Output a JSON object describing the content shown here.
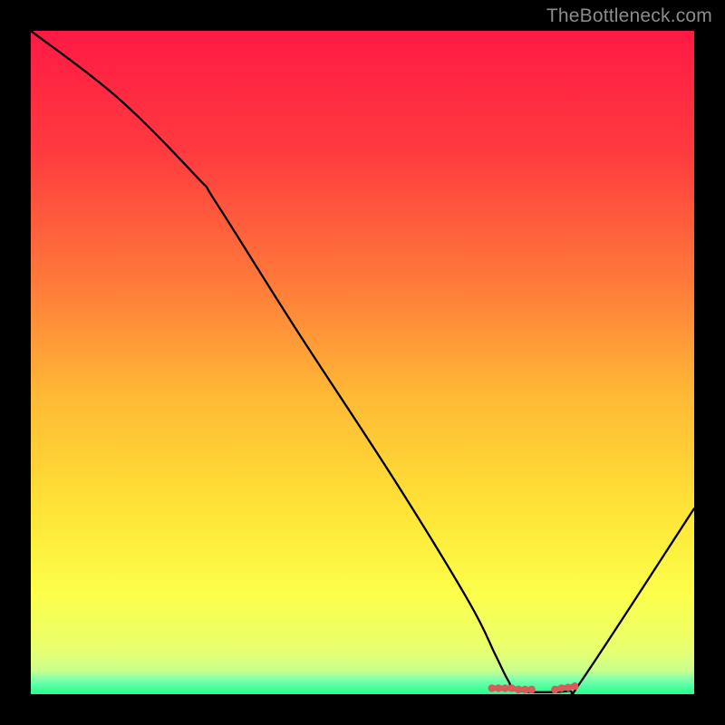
{
  "watermark": "TheBottleneck.com",
  "chart_data": {
    "type": "line",
    "title": "",
    "xlabel": "",
    "ylabel": "",
    "xlim": [
      0,
      100
    ],
    "ylim": [
      0,
      100
    ],
    "gradient": {
      "stops": [
        {
          "offset": 0,
          "color": "#ff1a44"
        },
        {
          "offset": 18,
          "color": "#ff3a3f"
        },
        {
          "offset": 38,
          "color": "#ff7a3a"
        },
        {
          "offset": 55,
          "color": "#ffb936"
        },
        {
          "offset": 72,
          "color": "#ffe336"
        },
        {
          "offset": 85,
          "color": "#fcff4a"
        },
        {
          "offset": 93,
          "color": "#eaff6d"
        },
        {
          "offset": 96.5,
          "color": "#c8ff8e"
        },
        {
          "offset": 97.8,
          "color": "#7dffad"
        },
        {
          "offset": 100,
          "color": "#21ff8f"
        }
      ]
    },
    "series": [
      {
        "name": "curve",
        "x": [
          0,
          13,
          25,
          28,
          40,
          55,
          66,
          70,
          72,
          73.5,
          81,
          83,
          100
        ],
        "values": [
          100,
          90,
          78,
          74,
          55,
          32,
          14,
          6,
          2,
          0.5,
          0.5,
          2,
          28
        ]
      }
    ],
    "markers": {
      "comment": "red dashed/dotted segment near the valley",
      "x": [
        69.5,
        70.5,
        71.5,
        72.5,
        73.5,
        74.5,
        75.5,
        79,
        80,
        81,
        82
      ],
      "values": [
        0.9,
        0.9,
        0.9,
        0.9,
        0.7,
        0.7,
        0.7,
        0.7,
        0.9,
        1.0,
        1.2
      ],
      "color": "#d85a5a"
    }
  }
}
